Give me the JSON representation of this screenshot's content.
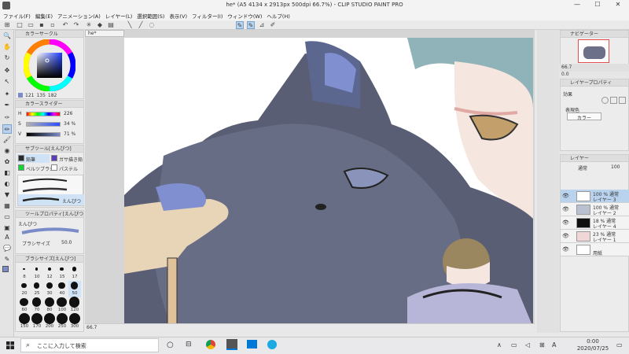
{
  "window": {
    "title": "he* (A5 4134 x 2913px 500dpi 66.7%) - CLIP STUDIO PAINT PRO",
    "minimize": "—",
    "maximize": "☐",
    "close": "✕"
  },
  "menu": [
    "ファイル(F)",
    "編集(E)",
    "アニメーション(A)",
    "レイヤー(L)",
    "選択範囲(S)",
    "表示(V)",
    "フィルター(I)",
    "ウィンドウ(W)",
    "ヘルプ(H)"
  ],
  "doc_tab": "he*",
  "color_wheel_panel": {
    "title": "カラーサークル",
    "hsv": [
      "121",
      "135",
      "182"
    ]
  },
  "color_slider_panel": {
    "title": "カラースライダー",
    "rows": [
      {
        "label": "H",
        "value": "226"
      },
      {
        "label": "S",
        "value": "34 %"
      },
      {
        "label": "V",
        "value": "71 %"
      }
    ]
  },
  "subtool_panel": {
    "title": "サブツール[えんぴつ]",
    "buttons": [
      "鉛筆",
      "ガサ描き鉛",
      "ベルツブラシ",
      "パステル"
    ],
    "brushes": [
      "",
      "",
      "えんぴつ"
    ]
  },
  "tool_prop_panel": {
    "title": "ツールプロパティ[えんぴつ]",
    "name": "えんぴつ",
    "size_label": "ブラシサイズ",
    "size_value": "50.0"
  },
  "brush_size_panel": {
    "title": "ブラシサイズ[えんぴつ]",
    "sizes": [
      "8",
      "10",
      "12",
      "15",
      "17",
      "20",
      "25",
      "30",
      "40",
      "50",
      "60",
      "70",
      "80",
      "100",
      "120",
      "150",
      "170",
      "200",
      "250",
      "300"
    ]
  },
  "canvas": {
    "zoom": "66.7"
  },
  "navigator": {
    "title": "ナビゲーター",
    "zoom": "66.7",
    "angle": "0.0"
  },
  "layer_props": {
    "title": "レイヤープロパティ",
    "effect_label": "効果",
    "expression_label": "表現色",
    "expression_value": "カラー"
  },
  "layer_panel": {
    "title": "レイヤー",
    "blend": "通常",
    "opacity": "100",
    "layers": [
      {
        "line1": "100 % 通常",
        "line2": "レイヤー 3",
        "selected": true
      },
      {
        "line1": "100 % 通常",
        "line2": "レイヤー 2",
        "selected": false
      },
      {
        "line1": "18 % 通常",
        "line2": "レイヤー 4",
        "selected": false
      },
      {
        "line1": "23 % 通常",
        "line2": "レイヤー 1",
        "selected": false
      },
      {
        "line1": "",
        "line2": "用紙",
        "selected": false
      }
    ]
  },
  "taskbar": {
    "search_placeholder": "ここに入力して検索",
    "time": "0:00",
    "date": "2020/07/25",
    "ime": "A"
  },
  "colors": {
    "main": "#7a8bc8",
    "sub": "#ffffff",
    "accent": "#0078d7"
  }
}
